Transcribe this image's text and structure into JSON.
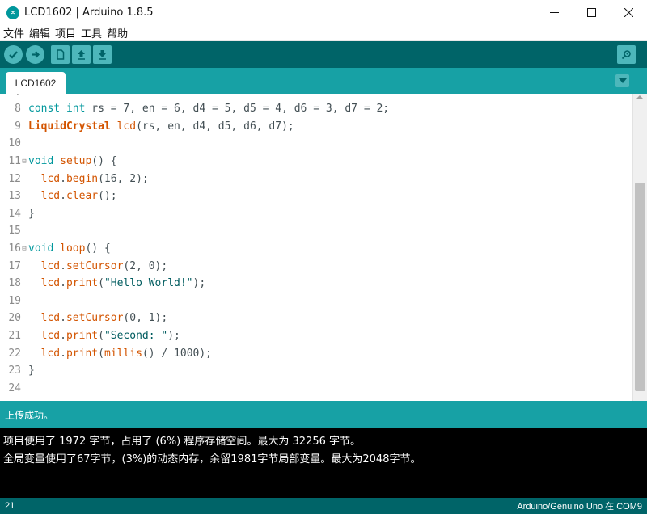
{
  "window": {
    "app_icon_label": "∞",
    "title": "LCD1602 | Arduino 1.8.5"
  },
  "menu": {
    "items": [
      "文件",
      "编辑",
      "项目",
      "工具",
      "帮助"
    ]
  },
  "toolbar": {
    "buttons": [
      "verify-icon",
      "upload-icon",
      "new-icon",
      "open-icon",
      "save-icon",
      "serial-monitor-icon"
    ]
  },
  "tabs": {
    "active": "LCD1602"
  },
  "editor": {
    "top_stub": "·",
    "lines": [
      {
        "no": "8",
        "fold": "",
        "code": "const int rs = 7, en = 6, d4 = 5, d5 = 4, d6 = 3, d7 = 2;"
      },
      {
        "no": "9",
        "fold": "",
        "code": "LiquidCrystal lcd(rs, en, d4, d5, d6, d7);"
      },
      {
        "no": "10",
        "fold": "",
        "code": ""
      },
      {
        "no": "11",
        "fold": "⊟",
        "code": "void setup() {"
      },
      {
        "no": "12",
        "fold": "",
        "code": "  lcd.begin(16, 2);"
      },
      {
        "no": "13",
        "fold": "",
        "code": "  lcd.clear();"
      },
      {
        "no": "14",
        "fold": "",
        "code": "}"
      },
      {
        "no": "15",
        "fold": "",
        "code": ""
      },
      {
        "no": "16",
        "fold": "⊟",
        "code": "void loop() {"
      },
      {
        "no": "17",
        "fold": "",
        "code": "  lcd.setCursor(2, 0);"
      },
      {
        "no": "18",
        "fold": "",
        "code": "  lcd.print(\"Hello World!\");"
      },
      {
        "no": "19",
        "fold": "",
        "code": ""
      },
      {
        "no": "20",
        "fold": "",
        "code": "  lcd.setCursor(0, 1);"
      },
      {
        "no": "21",
        "fold": "",
        "code": "  lcd.print(\"Second: \");"
      },
      {
        "no": "22",
        "fold": "",
        "code": "  lcd.print(millis() / 1000);"
      },
      {
        "no": "23",
        "fold": "",
        "code": "}"
      },
      {
        "no": "24",
        "fold": "",
        "code": ""
      }
    ]
  },
  "status": {
    "message": "上传成功。"
  },
  "console": {
    "lines": [
      "项目使用了 1972 字节，占用了 (6%) 程序存储空间。最大为 32256 字节。",
      "全局变量使用了67字节，(3%)的动态内存，余留1981字节局部变量。最大为2048字节。"
    ]
  },
  "footer": {
    "line_number": "21",
    "board": "Arduino/Genuino Uno 在 COM9"
  },
  "colors": {
    "toolbar": "#006468",
    "tabstrip": "#17a1a5",
    "button": "#4db7bb",
    "keyword": "#00979c",
    "function": "#d35400"
  }
}
